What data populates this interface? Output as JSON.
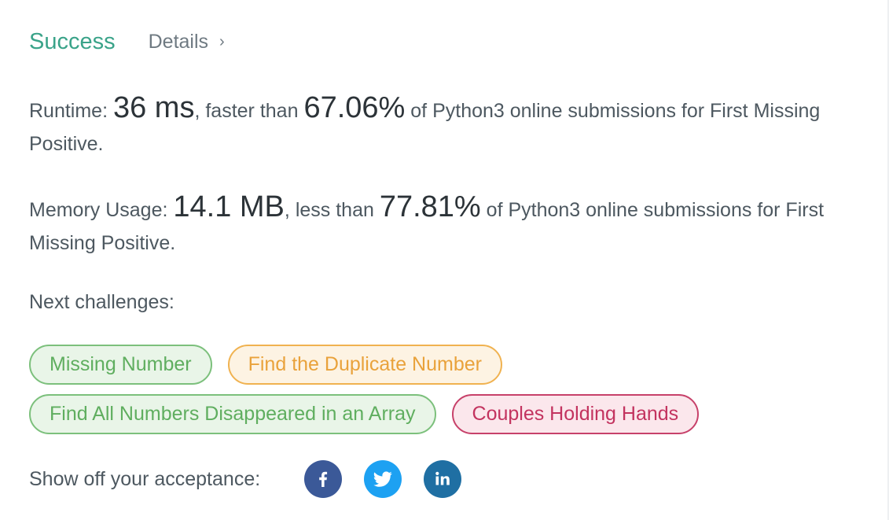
{
  "status": {
    "label": "Success",
    "details_label": "Details",
    "chevron": "›"
  },
  "runtime": {
    "prefix": "Runtime: ",
    "value": "36 ms",
    "mid": ", faster than ",
    "percent": "67.06%",
    "suffix": " of Python3 online submissions for First Missing Positive."
  },
  "memory": {
    "prefix": "Memory Usage: ",
    "value": "14.1 MB",
    "mid": ", less than ",
    "percent": "77.81%",
    "suffix": " of Python3 online submissions for First Missing Positive."
  },
  "next": {
    "label": "Next challenges:",
    "challenges": [
      {
        "label": "Missing Number",
        "difficulty": "easy"
      },
      {
        "label": "Find the Duplicate Number",
        "difficulty": "medium"
      },
      {
        "label": "Find All Numbers Disappeared in an Array",
        "difficulty": "easy"
      },
      {
        "label": "Couples Holding Hands",
        "difficulty": "hard"
      }
    ]
  },
  "share": {
    "label": "Show off your acceptance:",
    "icons": [
      "facebook-icon",
      "twitter-icon",
      "linkedin-icon"
    ]
  },
  "colors": {
    "success": "#3aa389",
    "easy": "#5fae5f",
    "medium": "#e9a23b",
    "hard": "#c3335f",
    "facebook": "#3b5998",
    "twitter": "#1da1f2",
    "linkedin": "#1f6fa3"
  }
}
